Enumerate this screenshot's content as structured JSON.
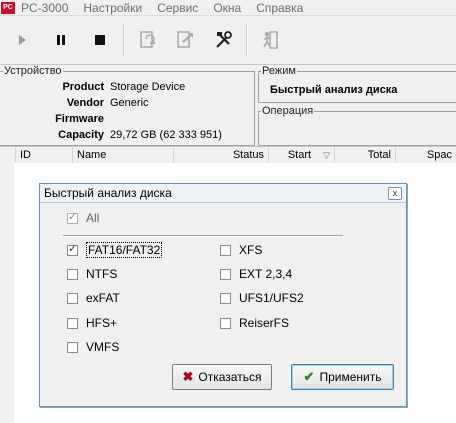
{
  "app": {
    "logo_text": "PC",
    "title": "PC-3000"
  },
  "menu": {
    "items": [
      "Настройки",
      "Сервис",
      "Окна",
      "Справка"
    ]
  },
  "toolbar": {
    "buttons": [
      "play-icon",
      "pause-icon",
      "stop-icon",
      "task-refresh-icon",
      "task-export-icon",
      "tools-icon",
      "exit-icon"
    ]
  },
  "device": {
    "group_title": "Устройство",
    "rows": [
      {
        "key": "Product",
        "value": "Storage Device"
      },
      {
        "key": "Vendor",
        "value": "Generic"
      },
      {
        "key": "Firmware",
        "value": ""
      },
      {
        "key": "Capacity",
        "value": "29,72 GB (62 333 951)"
      }
    ]
  },
  "mode": {
    "group_title": "Режим",
    "value": "Быстрый анализ диска"
  },
  "operation": {
    "group_title": "Операция"
  },
  "table": {
    "columns": [
      "ID",
      "Name",
      "Status",
      "Start",
      "Total",
      "Spac"
    ],
    "sort_indicator": "▽"
  },
  "dialog": {
    "title": "Быстрый анализ диска",
    "close_label": "x",
    "all_label": "All",
    "fs_left": [
      {
        "label": "FAT16/FAT32",
        "checked": true
      },
      {
        "label": "NTFS",
        "checked": false
      },
      {
        "label": "exFAT",
        "checked": false
      },
      {
        "label": "HFS+",
        "checked": false
      },
      {
        "label": "VMFS",
        "checked": false
      }
    ],
    "fs_right": [
      {
        "label": "XFS",
        "checked": false
      },
      {
        "label": "EXT 2,3,4",
        "checked": false
      },
      {
        "label": "UFS1/UFS2",
        "checked": false
      },
      {
        "label": "ReiserFS",
        "checked": false
      }
    ],
    "cancel_label": "Отказаться",
    "apply_label": "Применить",
    "cancel_icon": "✖",
    "apply_icon": "✔"
  }
}
